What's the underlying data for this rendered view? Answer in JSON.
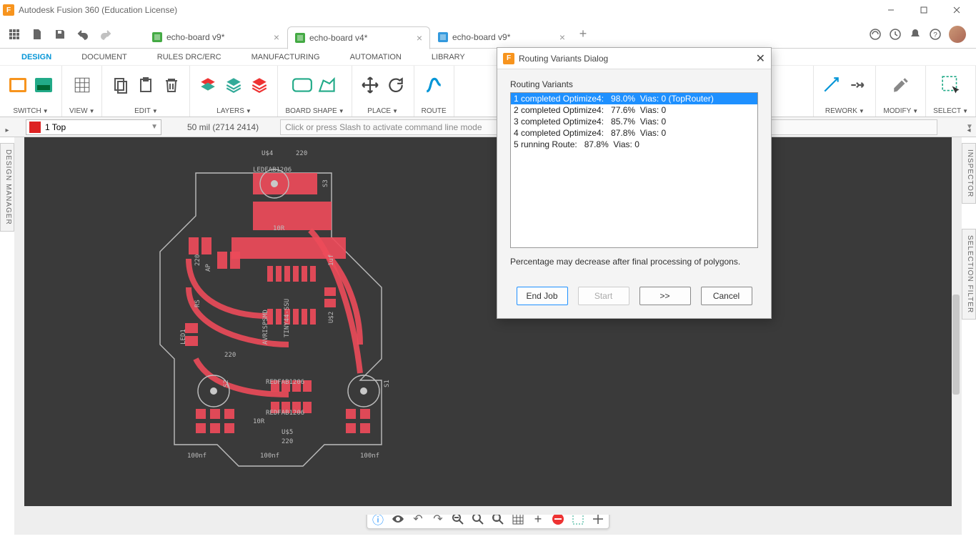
{
  "app": {
    "title": "Autodesk Fusion 360 (Education License)"
  },
  "tabs": [
    {
      "label": "echo-board v9*",
      "active": false,
      "color": "#3a9"
    },
    {
      "label": "echo-board v4*",
      "active": true,
      "color": "#3a9"
    },
    {
      "label": "echo-board v9*",
      "active": false,
      "color": "#39d"
    }
  ],
  "menu": {
    "items": [
      "DESIGN",
      "DOCUMENT",
      "RULES DRC/ERC",
      "MANUFACTURING",
      "AUTOMATION",
      "LIBRARY"
    ],
    "active": 0
  },
  "ribbon": {
    "groups": [
      {
        "label": "SWITCH",
        "caret": true
      },
      {
        "label": "VIEW",
        "caret": true
      },
      {
        "label": "EDIT",
        "caret": true
      },
      {
        "label": "LAYERS",
        "caret": true
      },
      {
        "label": "BOARD SHAPE",
        "caret": true
      },
      {
        "label": "PLACE",
        "caret": true
      },
      {
        "label": "ROUTE",
        "caret": true,
        "cut": true
      },
      {
        "label": "REWORK",
        "caret": true
      },
      {
        "label": "MODIFY",
        "caret": true
      },
      {
        "label": "SELECT",
        "caret": true
      }
    ]
  },
  "layer": {
    "name": "1 Top",
    "color": "#d22"
  },
  "status": {
    "coord": "50 mil (2714 2414)",
    "cmd_placeholder": "Click or press Slash to activate command line mode"
  },
  "side": {
    "left": "DESIGN MANAGER",
    "right1": "INSPECTOR",
    "right2": "SELECTION FILTER"
  },
  "dialog": {
    "title": "Routing Variants Dialog",
    "heading": "Routing Variants",
    "variants": [
      "1 completed Optimize4:   98.0%  Vias: 0 (TopRouter)",
      "2 completed Optimize4:   77.6%  Vias: 0",
      "3 completed Optimize4:   85.7%  Vias: 0",
      "4 completed Optimize4:   87.8%  Vias: 0",
      "5 running Route:   87.8%  Vias: 0"
    ],
    "selected": 0,
    "note": "Percentage may decrease after final processing of polygons.",
    "buttons": {
      "end": "End Job",
      "start": "Start",
      "next": ">>",
      "cancel": "Cancel"
    }
  },
  "pcb_labels": [
    "U$4",
    "220",
    "LEDFAB1206",
    "S3",
    "10R",
    "S2",
    "REDFAB1206",
    "REDFAB1206",
    "10R",
    "U$5",
    "220",
    "100nf",
    "100nf",
    "100nf",
    "S1",
    "LED1",
    "AVRISPSMD",
    "TINY44-SSU",
    "U$2",
    "1uf",
    "220",
    "220",
    "AP",
    "RS"
  ]
}
